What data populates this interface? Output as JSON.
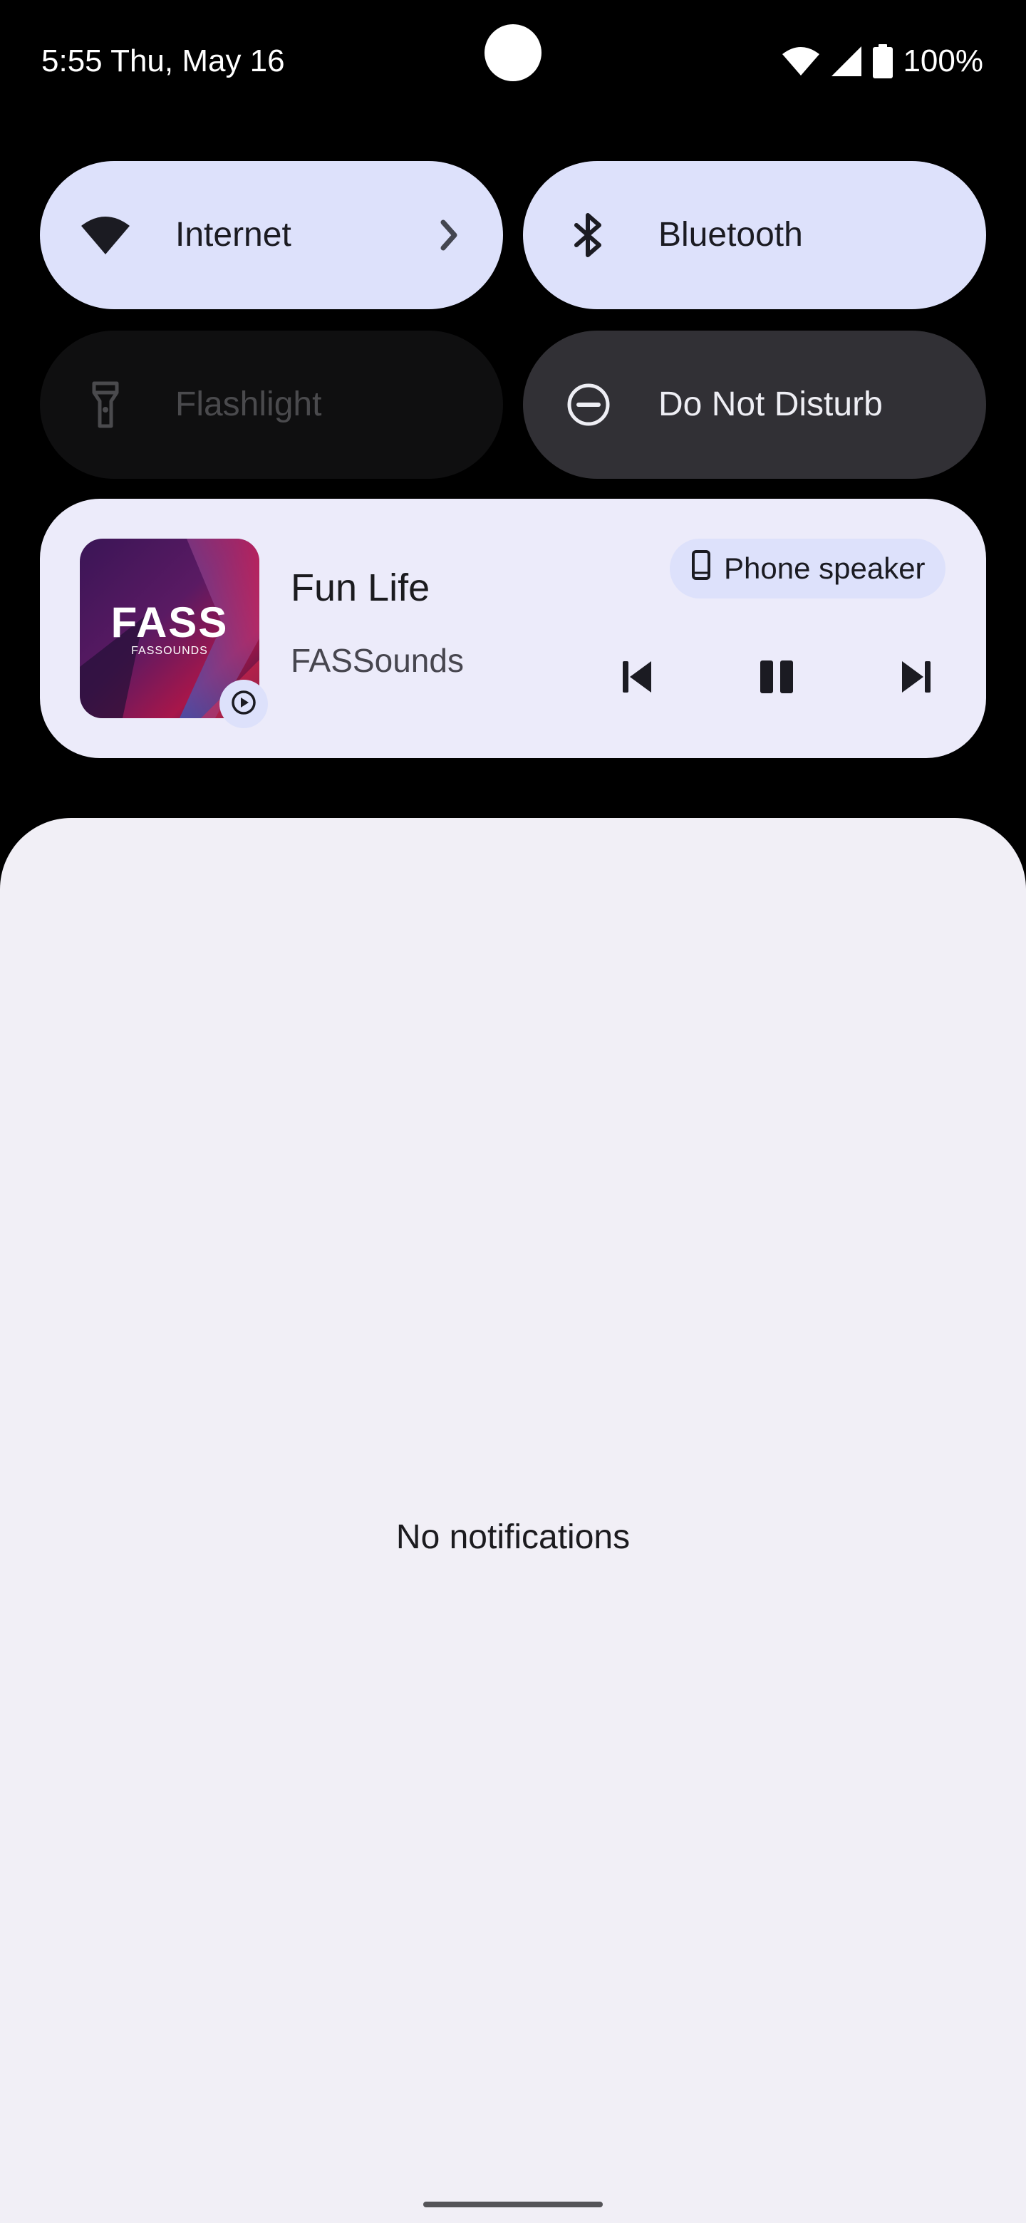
{
  "status_bar": {
    "time_date": "5:55 Thu, May 16",
    "battery": "100%",
    "icons": [
      "wifi-icon",
      "cellular-signal-icon",
      "battery-icon"
    ]
  },
  "quick_settings": {
    "tiles": [
      {
        "label": "Internet",
        "icon": "wifi-icon",
        "state": "on"
      },
      {
        "label": "Bluetooth",
        "icon": "bluetooth-icon",
        "state": "on"
      },
      {
        "label": "Flashlight",
        "icon": "flashlight-icon",
        "state": "unavailable"
      },
      {
        "label": "Do Not Disturb",
        "icon": "do-not-disturb-icon",
        "state": "off"
      }
    ]
  },
  "media": {
    "title": "Fun Life",
    "artist": "FASSounds",
    "output_device": "Phone speaker",
    "album_art_text": "FASS",
    "album_art_subtext": "FASSOUNDS",
    "controls": [
      "skip-previous-icon",
      "pause-icon",
      "skip-next-icon"
    ]
  },
  "notifications": {
    "empty_text": "No notifications"
  },
  "colors": {
    "tile_active": "#dde1fb",
    "tile_inactive": "#313035",
    "media_background": "#ecebfa",
    "shade_background": "#f1eff6"
  }
}
